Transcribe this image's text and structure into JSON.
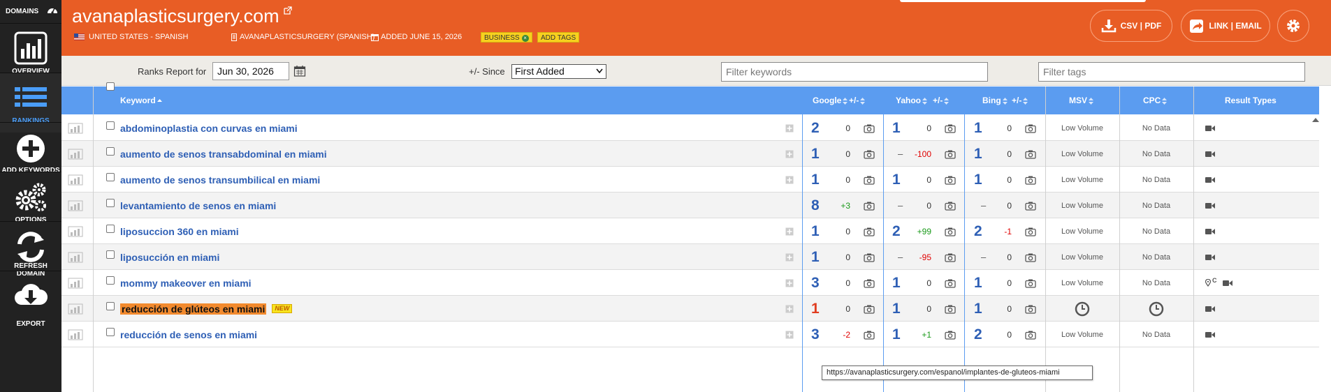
{
  "sidebar": {
    "domains_label": "DOMAINS",
    "items": [
      {
        "label": "OVERVIEW",
        "icon": "bar-chart-icon"
      },
      {
        "label": "RANKINGS",
        "icon": "list-icon",
        "active": true
      },
      {
        "label": "ADD KEYWORDS",
        "icon": "add-circle-icon"
      },
      {
        "label": "OPTIONS",
        "icon": "gears-icon"
      },
      {
        "label": "REFRESH DOMAIN",
        "icon": "refresh-icon"
      },
      {
        "label": "EXPORT",
        "icon": "cloud-download-icon"
      }
    ]
  },
  "header": {
    "domain": "avanaplasticsurgery.com",
    "location": "UNITED STATES - SPANISH",
    "site": "AVANAPLASTICSURGERY (SPANISH)",
    "added": "ADDED JUNE 15, 2026",
    "tag": "BUSINESS",
    "add_tags": "ADD TAGS",
    "csv_pdf": "CSV | PDF",
    "link_email": "LINK | EMAIL",
    "accent": "#e85d25"
  },
  "filters": {
    "ranks_report_label": "Ranks Report for",
    "date": "Jun 30, 2026",
    "since_label": "+/- Since",
    "since_value": "First Added",
    "filter_keywords_placeholder": "Filter keywords",
    "filter_tags_placeholder": "Filter tags"
  },
  "table": {
    "headers": {
      "keyword": "Keyword",
      "google": "Google",
      "yahoo": "Yahoo",
      "bing": "Bing",
      "change": "+/-",
      "msv": "MSV",
      "cpc": "CPC",
      "result_types": "Result Types"
    },
    "rows": [
      {
        "keyword": "abdominoplastia con curvas en miami",
        "google": "2",
        "g_chg": "0",
        "yahoo": "1",
        "y_chg": "0",
        "bing": "1",
        "b_chg": "0",
        "msv": "Low Volume",
        "cpc": "No Data"
      },
      {
        "keyword": "aumento de senos transabdominal en miami",
        "google": "1",
        "g_chg": "0",
        "yahoo": "–",
        "y_chg": "-100",
        "bing": "1",
        "b_chg": "0",
        "msv": "Low Volume",
        "cpc": "No Data"
      },
      {
        "keyword": "aumento de senos transumbilical en miami",
        "google": "1",
        "g_chg": "0",
        "yahoo": "1",
        "y_chg": "0",
        "bing": "1",
        "b_chg": "0",
        "msv": "Low Volume",
        "cpc": "No Data"
      },
      {
        "keyword": "levantamiento de senos en miami",
        "google": "8",
        "g_chg": "+3",
        "yahoo": "–",
        "y_chg": "0",
        "bing": "–",
        "b_chg": "0",
        "msv": "Low Volume",
        "cpc": "No Data"
      },
      {
        "keyword": "liposuccion 360 en miami",
        "google": "1",
        "g_chg": "0",
        "yahoo": "2",
        "y_chg": "+99",
        "bing": "2",
        "b_chg": "-1",
        "msv": "Low Volume",
        "cpc": "No Data"
      },
      {
        "keyword": "liposucción en miami",
        "google": "1",
        "g_chg": "0",
        "yahoo": "–",
        "y_chg": "-95",
        "bing": "–",
        "b_chg": "0",
        "msv": "Low Volume",
        "cpc": "No Data"
      },
      {
        "keyword": "mommy makeover en miami",
        "google": "3",
        "g_chg": "0",
        "yahoo": "1",
        "y_chg": "0",
        "bing": "1",
        "b_chg": "0",
        "msv": "Low Volume",
        "cpc": "No Data",
        "local_c": "C"
      },
      {
        "keyword": "reducción de glúteos en miami",
        "google": "1",
        "g_chg": "0",
        "yahoo": "1",
        "y_chg": "0",
        "bing": "1",
        "b_chg": "0",
        "new_badge": "NEW"
      },
      {
        "keyword": "reducción de senos en miami",
        "google": "3",
        "g_chg": "-2",
        "yahoo": "1",
        "y_chg": "+1",
        "bing": "2",
        "b_chg": "0",
        "msv": "Low Volume",
        "cpc": "No Data"
      }
    ]
  },
  "tooltip": "https://avanaplasticsurgery.com/espanol/implantes-de-gluteos-miami"
}
